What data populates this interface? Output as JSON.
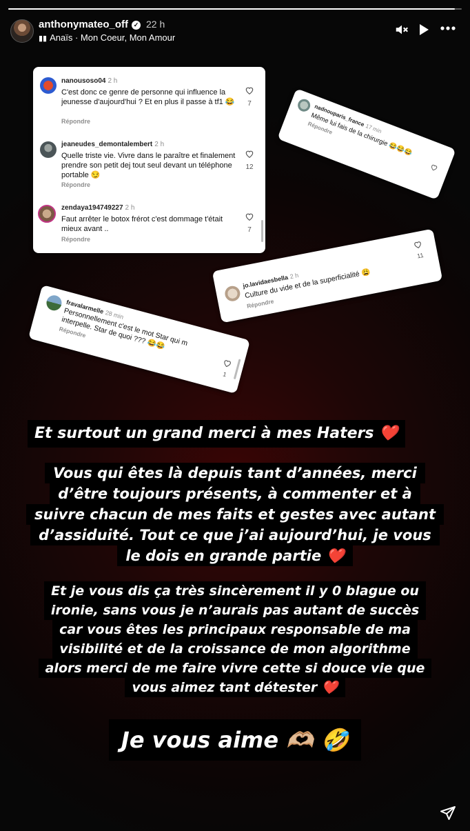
{
  "story": {
    "progress": 0.985
  },
  "header": {
    "username": "anthonymateo_off",
    "time": "22 h",
    "music": "Anaïs · Mon Coeur, Mon Amour"
  },
  "comments": [
    {
      "user": "nanousoso04",
      "time": "2 h",
      "text": "C'est donc ce genre de personne qui influence la jeunesse d'aujourd'hui ? Et en plus il passe à tf1 😂",
      "reply": "Répondre",
      "likes": "7"
    },
    {
      "user": "jeaneudes_demontalembert",
      "time": "2 h",
      "text": "Quelle triste vie. Vivre dans le paraître et finalement prendre son petit dej tout seul devant un téléphone portable 😏",
      "reply": "Répondre",
      "likes": "12"
    },
    {
      "user": "zendaya194749227",
      "time": "2 h",
      "text": "Faut arrêter  le botox frérot c'est dommage t'était mieux avant ..",
      "reply": "Répondre",
      "likes": "7"
    },
    {
      "user": "nadnouparis_france",
      "time": "17 min",
      "text": "Même lui fais de la chirurgie 😂😂😂",
      "reply": "Répondre",
      "likes": ""
    },
    {
      "user": "jo.lavidaesbella",
      "time": "2 h",
      "text": "Culture du vide et de la superficialité 😩",
      "reply": "Répondre",
      "likes": "11"
    },
    {
      "user": "fravalarmelle",
      "time": "28 min",
      "text": "Personnellement c'est le mot Star qui m interpelle.  Star de quoi ??? 😂😂",
      "reply": "Répondre",
      "likes": "1"
    }
  ],
  "messages": {
    "line1": "Et surtout un grand merci à mes Haters ❤️",
    "para1": [
      "Vous qui êtes là depuis tant d’années, merci",
      "d’être toujours présents, à commenter et à",
      "suivre chacun de mes faits et gestes avec autant",
      "d’assiduité. Tout ce que j’ai aujourd’hui, je vous",
      "le dois en grande partie ❤️"
    ],
    "para2": [
      "Et je vous dis ça très sincèrement il y 0 blague ou",
      "ironie, sans vous je n’aurais pas autant de succès",
      "car vous êtes les principaux responsable de ma",
      "visibilité et de la croissance de mon algorithme",
      "alors merci de me faire vivre cette si douce vie que",
      "vous aimez tant détester ❤️"
    ],
    "final": "Je vous aime 🫶🏼 🤣"
  },
  "icons": {
    "mute": "speaker-muted-icon",
    "play": "play-icon",
    "more": "more-icon",
    "share": "send-icon",
    "like": "heart-outline-icon"
  }
}
